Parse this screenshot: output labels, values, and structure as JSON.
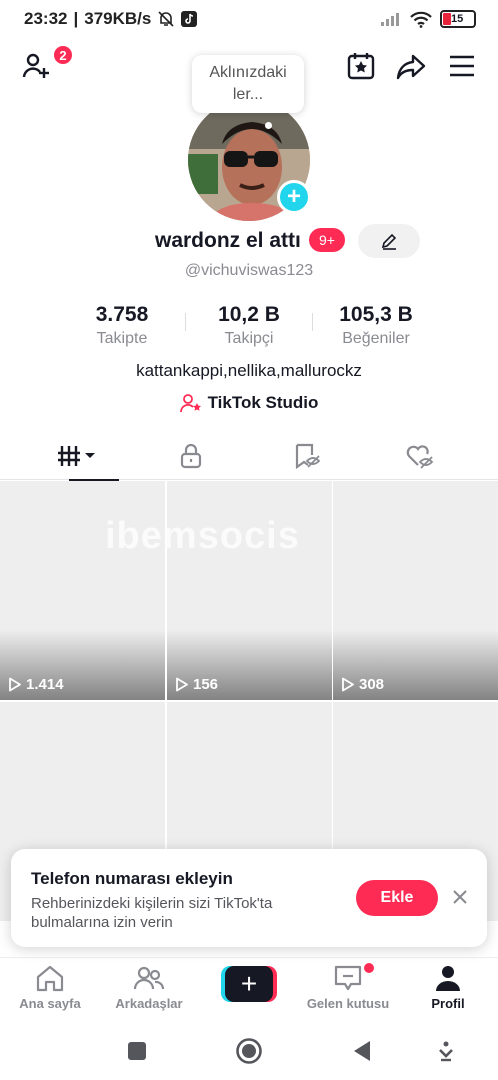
{
  "status_bar": {
    "time": "23:32",
    "network_speed": "379KB/s",
    "battery": "15"
  },
  "bubble": {
    "text": "Aklınızdaki ler..."
  },
  "profile": {
    "username": "wardonz el attı",
    "badge": "9+",
    "handle": "@vichuviswas123",
    "bio": "kattankappi,nellika,mallurockz",
    "studio_label": "TikTok Studio"
  },
  "header": {
    "notification_count": "2"
  },
  "stats": [
    {
      "value": "3.758",
      "label": "Takipte"
    },
    {
      "value": "10,2 B",
      "label": "Takipçi"
    },
    {
      "value": "105,3 B",
      "label": "Beğeniler"
    }
  ],
  "tabs": [
    "videos-grid",
    "private",
    "reposts",
    "liked"
  ],
  "videos": [
    {
      "views": "1.414"
    },
    {
      "views": "156"
    },
    {
      "views": "308"
    },
    {
      "views": ""
    },
    {
      "views": ""
    },
    {
      "views": ""
    }
  ],
  "watermark": "ibemsocis",
  "toast": {
    "title": "Telefon numarası ekleyin",
    "body": "Rehberinizdeki kişilerin sizi TikTok'ta bulmalarına izin verin",
    "button": "Ekle"
  },
  "bottom_nav": [
    {
      "label": "Ana sayfa",
      "icon": "home-icon"
    },
    {
      "label": "Arkadaşlar",
      "icon": "friends-icon"
    },
    {
      "label": "",
      "icon": "create-icon"
    },
    {
      "label": "Gelen kutusu",
      "icon": "inbox-icon"
    },
    {
      "label": "Profil",
      "icon": "profile-icon"
    }
  ],
  "colors": {
    "accent": "#fe2c55",
    "cyan": "#20d5ec",
    "text": "#161823",
    "muted": "#8a8b91"
  }
}
